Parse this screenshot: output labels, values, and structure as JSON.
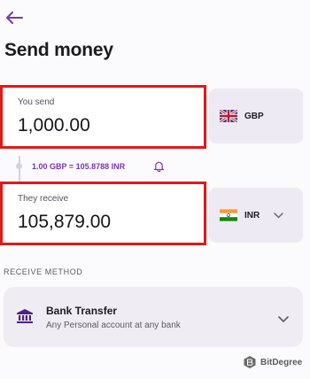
{
  "header": {
    "back_icon": "arrow-left-icon",
    "title": "Send money"
  },
  "send": {
    "label": "You send",
    "amount": "1,000.00",
    "currency": "GBP",
    "flag": "uk-flag-icon"
  },
  "rate": {
    "text": "1.00 GBP = 105.8788 INR",
    "icon": "bell-icon"
  },
  "receive": {
    "label": "They receive",
    "amount": "105,879.00",
    "currency": "INR",
    "flag": "india-flag-icon",
    "chevron": "chevron-down-icon"
  },
  "receive_method": {
    "section_label": "RECEIVE METHOD",
    "title": "Bank Transfer",
    "subtitle": "Any Personal account at any bank",
    "icon": "bank-icon"
  },
  "watermark": {
    "text": "BitDegree"
  },
  "colors": {
    "accent": "#7b36b4",
    "highlight": "#e01919"
  }
}
